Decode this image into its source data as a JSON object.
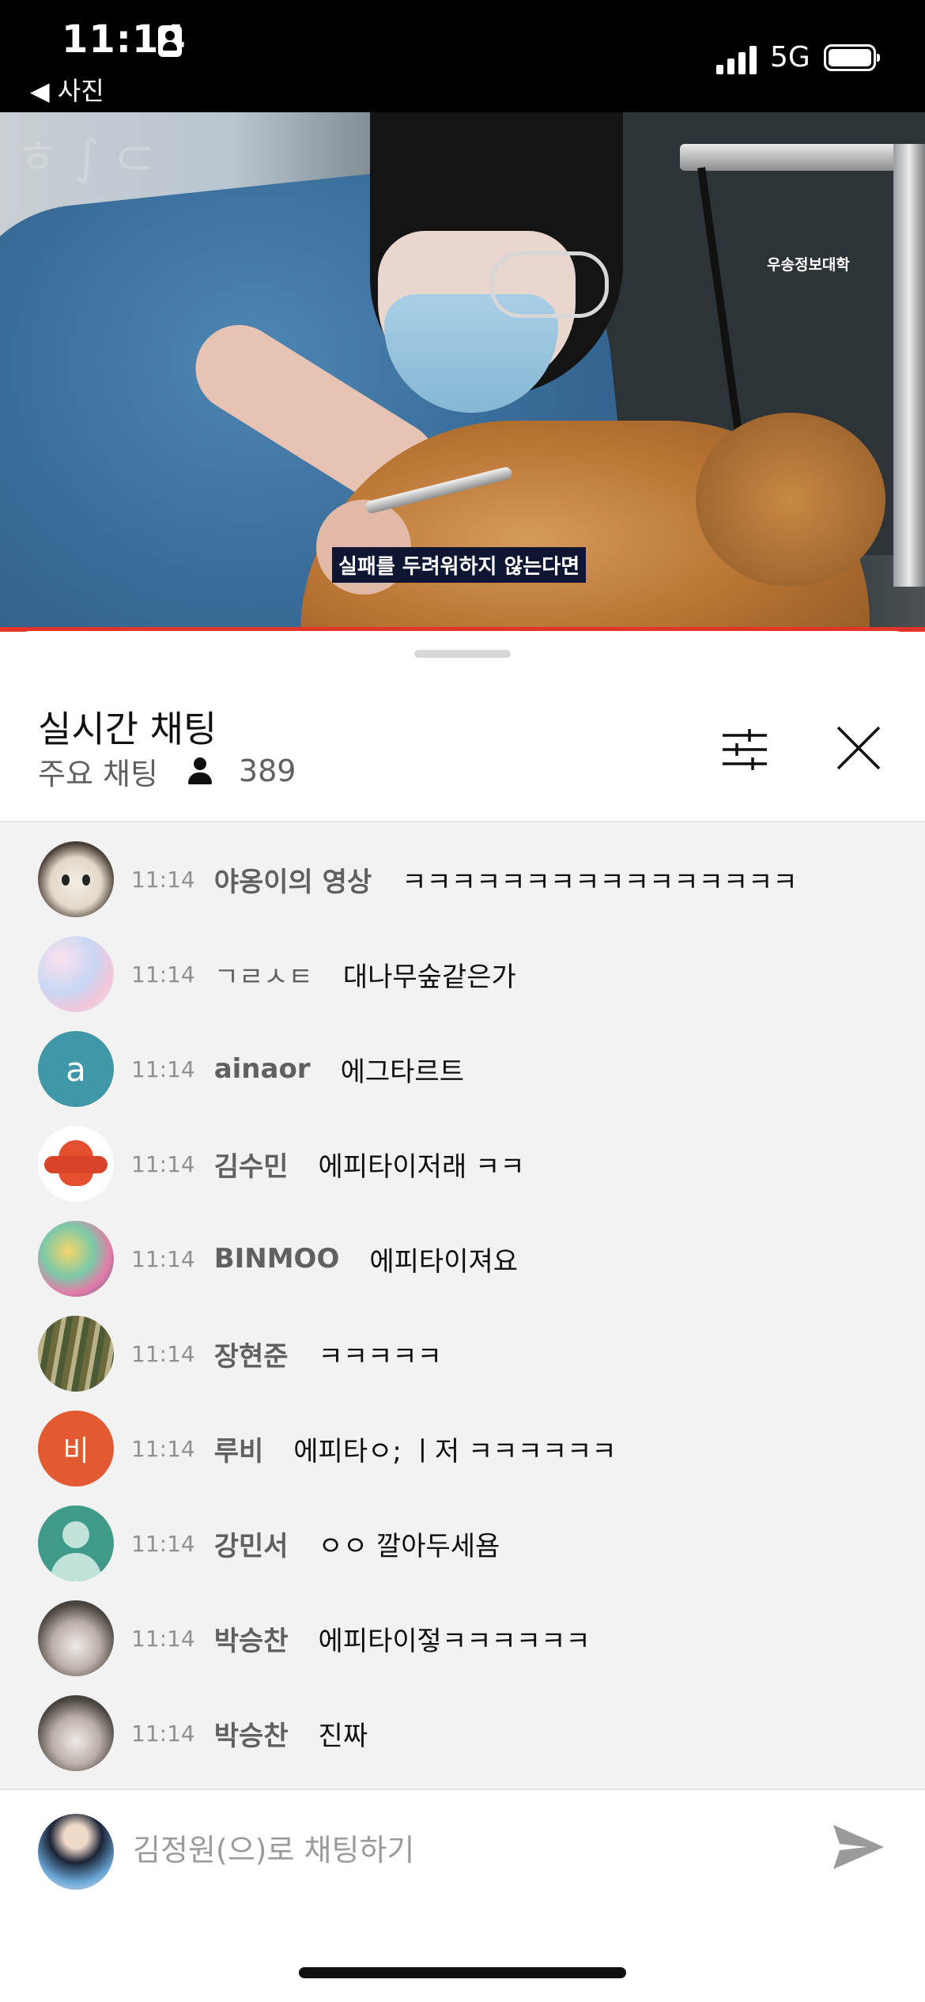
{
  "status_bar": {
    "time": "11:14",
    "back_label": "◀ 사진",
    "network": "5G"
  },
  "video": {
    "caption": "실패를 두려워하지 않는다면",
    "watermark": "우송정보대학"
  },
  "chat": {
    "title": "실시간 채팅",
    "mode_label": "주요 채팅",
    "viewer_count": "389",
    "messages": [
      {
        "time": "11:14",
        "author": "야옹이의 영상",
        "text": "ㅋㅋㅋㅋㅋㅋㅋㅋㅋㅋㅋㅋㅋㅋㅋㅋ"
      },
      {
        "time": "11:14",
        "author": "ㄱㄹㅅㅌ",
        "text": "대나무숲같은가"
      },
      {
        "time": "11:14",
        "author": "ainaor",
        "text": "에그타르트",
        "avatar_letter": "a"
      },
      {
        "time": "11:14",
        "author": "김수민",
        "text": "에피타이저래 ㅋㅋ"
      },
      {
        "time": "11:14",
        "author": "BINMOO",
        "text": "에피타이져요"
      },
      {
        "time": "11:14",
        "author": "장현준",
        "text": "ㅋㅋㅋㅋㅋ"
      },
      {
        "time": "11:14",
        "author": "루비",
        "text": "에피타ㅇ; ㅣ저 ㅋㅋㅋㅋㅋㅋ",
        "avatar_letter": "비"
      },
      {
        "time": "11:14",
        "author": "강민서",
        "text": "ㅇㅇ 깔아두세욤"
      },
      {
        "time": "11:14",
        "author": "박승찬",
        "text": "에피타이젛ㅋㅋㅋㅋㅋㅋ"
      },
      {
        "time": "11:14",
        "author": "박승찬",
        "text": "진짜"
      }
    ],
    "input_placeholder": "김정원(으)로 채팅하기"
  },
  "colors": {
    "progress_red": "#e1352a",
    "chat_background": "#f2f2f2",
    "avatar_teal": "#3f97a8",
    "avatar_orange": "#e35a32",
    "avatar_green": "#3f9b87"
  }
}
